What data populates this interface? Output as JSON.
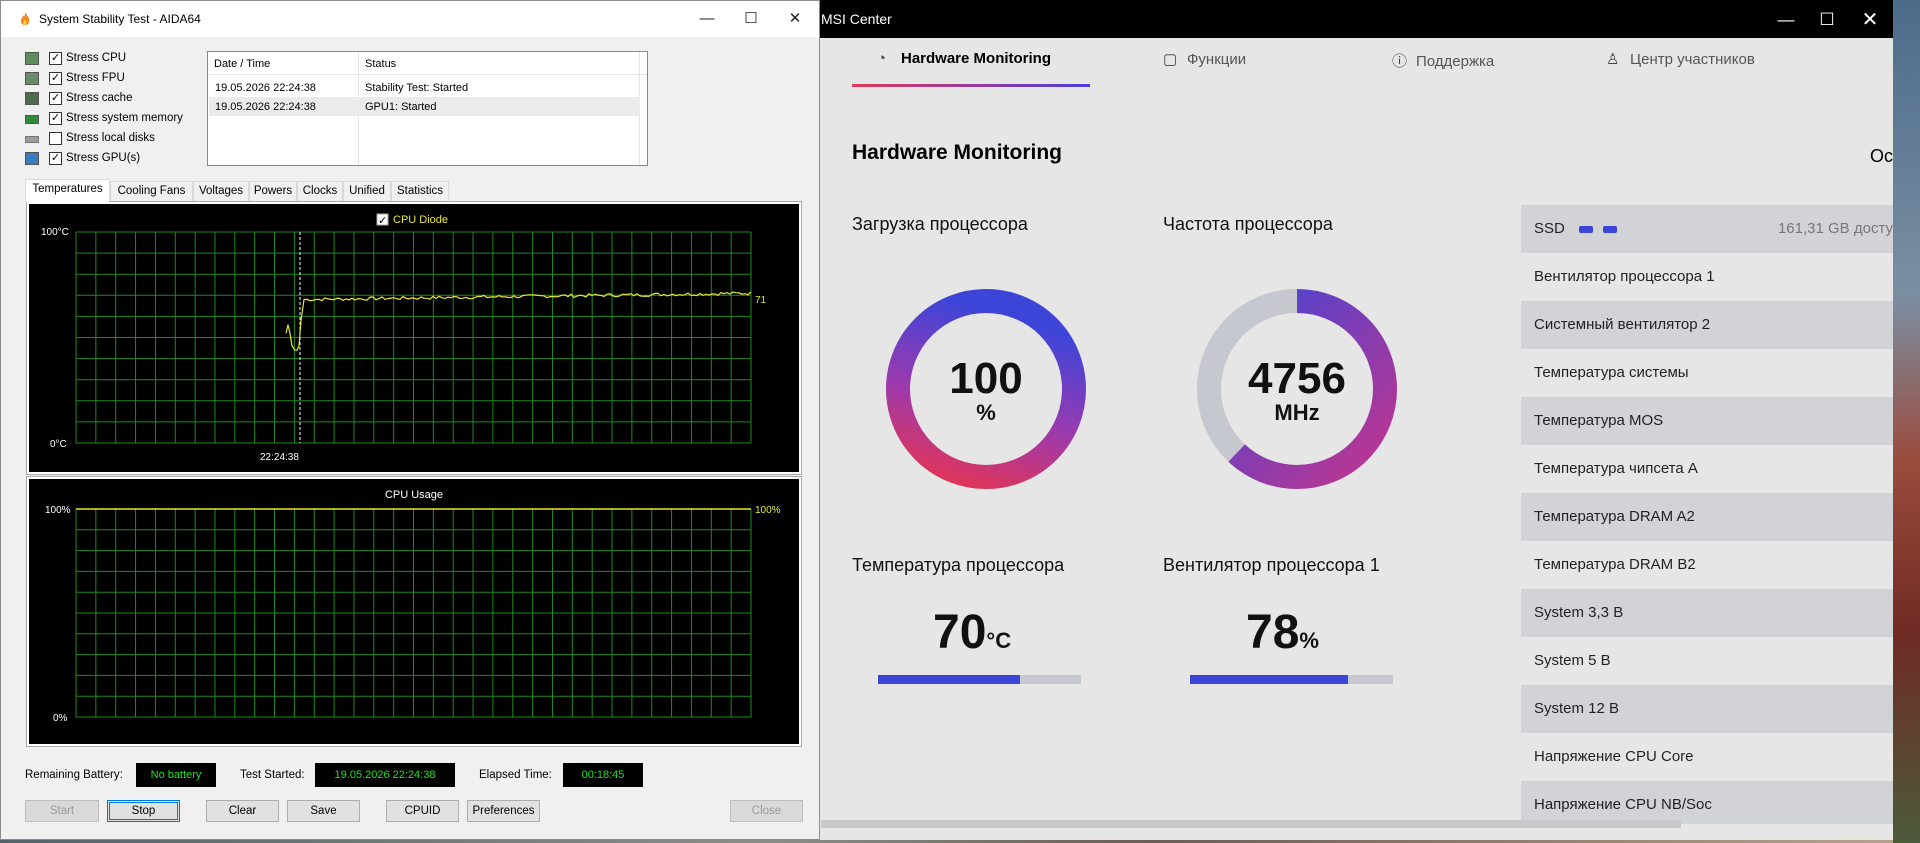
{
  "aida": {
    "title": "System Stability Test - AIDA64",
    "stress_items": [
      {
        "label": "Stress CPU",
        "checked": true
      },
      {
        "label": "Stress FPU",
        "checked": true
      },
      {
        "label": "Stress cache",
        "checked": true
      },
      {
        "label": "Stress system memory",
        "checked": true
      },
      {
        "label": "Stress local disks",
        "checked": false
      },
      {
        "label": "Stress GPU(s)",
        "checked": true
      }
    ],
    "log": {
      "col_date": "Date / Time",
      "col_status": "Status",
      "rows": [
        {
          "date": "19.05.2026 22:24:38",
          "status": "Stability Test: Started"
        },
        {
          "date": "19.05.2026 22:24:38",
          "status": "GPU1: Started"
        }
      ]
    },
    "tabs": [
      "Temperatures",
      "Cooling Fans",
      "Voltages",
      "Powers",
      "Clocks",
      "Unified",
      "Statistics"
    ],
    "temp_graph": {
      "legend": "CPU Diode",
      "y_top": "100°C",
      "y_bottom": "0°C",
      "time_label": "22:24:38",
      "current_value": "71",
      "current_value_num": 71,
      "line_color": "#e8e832"
    },
    "usage_graph": {
      "title": "CPU Usage",
      "y_top": "100%",
      "y_bottom": "0%",
      "current_value": "100%",
      "current_value_num": 100
    },
    "status": {
      "battery_label": "Remaining Battery:",
      "battery_value": "No battery",
      "started_label": "Test Started:",
      "started_value": "19.05.2026 22:24:38",
      "elapsed_label": "Elapsed Time:",
      "elapsed_value": "00:18:45"
    },
    "buttons": {
      "start": "Start",
      "stop": "Stop",
      "clear": "Clear",
      "save": "Save",
      "cpuid": "CPUID",
      "preferences": "Preferences",
      "close": "Close"
    }
  },
  "msi": {
    "title": "MSI Center",
    "nav": [
      {
        "label": "Hardware Monitoring",
        "icon": "gauge-icon"
      },
      {
        "label": "Функции",
        "icon": "features-icon"
      },
      {
        "label": "Поддержка",
        "icon": "support-icon"
      },
      {
        "label": "Центр участников",
        "icon": "user-icon"
      }
    ],
    "page_title": "Hardware Monitoring",
    "page_title_right": "Ос",
    "cpu_load": {
      "label": "Загрузка процессора",
      "value": "100",
      "unit": "%",
      "fraction": 1.0
    },
    "cpu_freq": {
      "label": "Частота процессора",
      "value": "4756",
      "unit": "MHz",
      "fraction": 0.62
    },
    "cpu_temp": {
      "label": "Температура процессора",
      "value": "70",
      "unit": "°C",
      "fraction": 0.7
    },
    "cpu_fan": {
      "label": "Вентилятор процессора 1",
      "value": "78",
      "unit": "%",
      "fraction": 0.78
    },
    "list": [
      {
        "label": "SSD",
        "right": "161,31 GB досту"
      },
      {
        "label": "Вентилятор процессора 1"
      },
      {
        "label": "Системный вентилятор 2"
      },
      {
        "label": "Температура системы"
      },
      {
        "label": "Температура MOS"
      },
      {
        "label": "Температура чипсета A"
      },
      {
        "label": "Температура DRAM A2"
      },
      {
        "label": "Температура DRAM B2"
      },
      {
        "label": "System 3,3 В"
      },
      {
        "label": "System 5 В"
      },
      {
        "label": "System 12 В"
      },
      {
        "label": "Напряжение CPU Core"
      },
      {
        "label": "Напряжение CPU NB/Soc"
      }
    ],
    "colors": {
      "accent_red": "#e8344e",
      "accent_blue": "#3d45d8",
      "gauge_track": "#c6c8d0"
    }
  }
}
